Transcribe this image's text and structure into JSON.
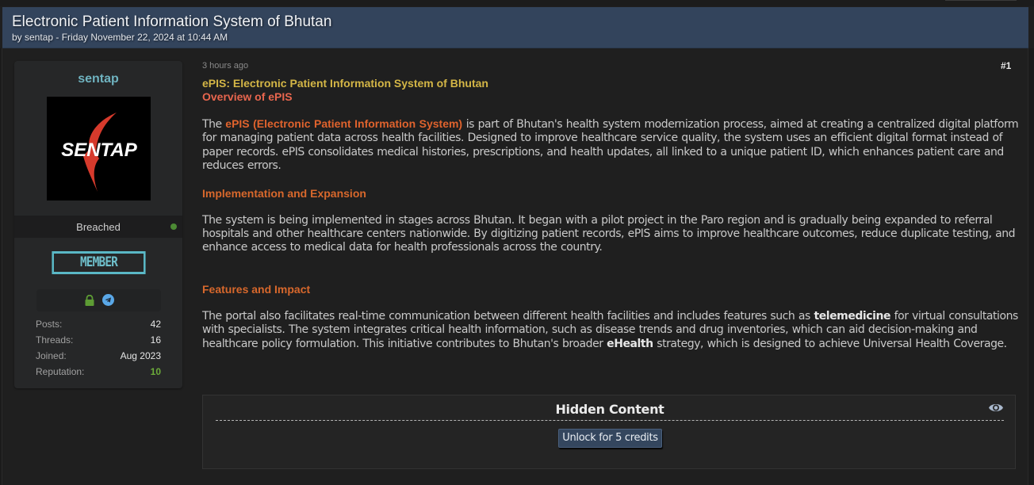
{
  "thread": {
    "title": "Electronic Patient Information System of Bhutan",
    "meta": "by sentap - Friday November 22, 2024 at 10:44 AM"
  },
  "user": {
    "username": "sentap",
    "avatar_text": "SENTAP",
    "group": "Breached",
    "online_status": "online",
    "rank": "MEMBER",
    "icons": [
      "lock-icon",
      "telegram-icon"
    ],
    "stats": [
      {
        "label": "Posts:",
        "value": "42"
      },
      {
        "label": "Threads:",
        "value": "16"
      },
      {
        "label": "Joined:",
        "value": "Aug 2023"
      },
      {
        "label": "Reputation:",
        "value": "10"
      }
    ]
  },
  "post": {
    "time": "3 hours ago",
    "number": "#1",
    "title": "ePIS: Electronic Patient Information System of Bhutan",
    "subtitle": "Overview of ePIS",
    "overview": {
      "pre": "The ",
      "highlight": "ePIS (Electronic Patient Information System)",
      "post": " is part of Bhutan's health system modernization process, aimed at creating a centralized digital platform for managing patient data across health facilities. Designed to improve healthcare service quality, the system uses an efficient digital format instead of paper records. ePIS consolidates medical histories, prescriptions, and health updates, all linked to a unique patient ID, which enhances patient care and reduces errors."
    },
    "section1_heading": "Implementation and Expansion",
    "section1_text": "The system is being implemented in stages across Bhutan. It began with a pilot project in the Paro region and is gradually being expanded to referral hospitals and other healthcare centers nationwide. By digitizing patient records, ePIS aims to improve healthcare outcomes, reduce duplicate testing, and enhance access to medical data for health professionals across the country.",
    "section2_heading": "Features and Impact",
    "section2": {
      "part1": "The portal also facilitates real-time communication between different health facilities and includes features such as ",
      "bold1": "telemedicine",
      "part2": " for virtual consultations with specialists. The system integrates critical health information, such as disease trends and drug inventories, which can aid decision-making and healthcare policy formulation. This initiative contributes to Bhutan's broader ",
      "bold2": "eHealth",
      "part3": " strategy, which is designed to achieve Universal Health Coverage."
    },
    "hidden": {
      "title": "Hidden Content",
      "unlock_label": "Unlock for 5 credits"
    }
  },
  "colors": {
    "header_bg": "#33445c",
    "username": "#6fb3c0",
    "post_title": "#d4b646",
    "post_subtitle": "#e8664e",
    "section_heading": "#d8682c",
    "reputation": "#6cab3a",
    "online": "#4c8a34",
    "rank_badge": "#5ab8c6"
  }
}
